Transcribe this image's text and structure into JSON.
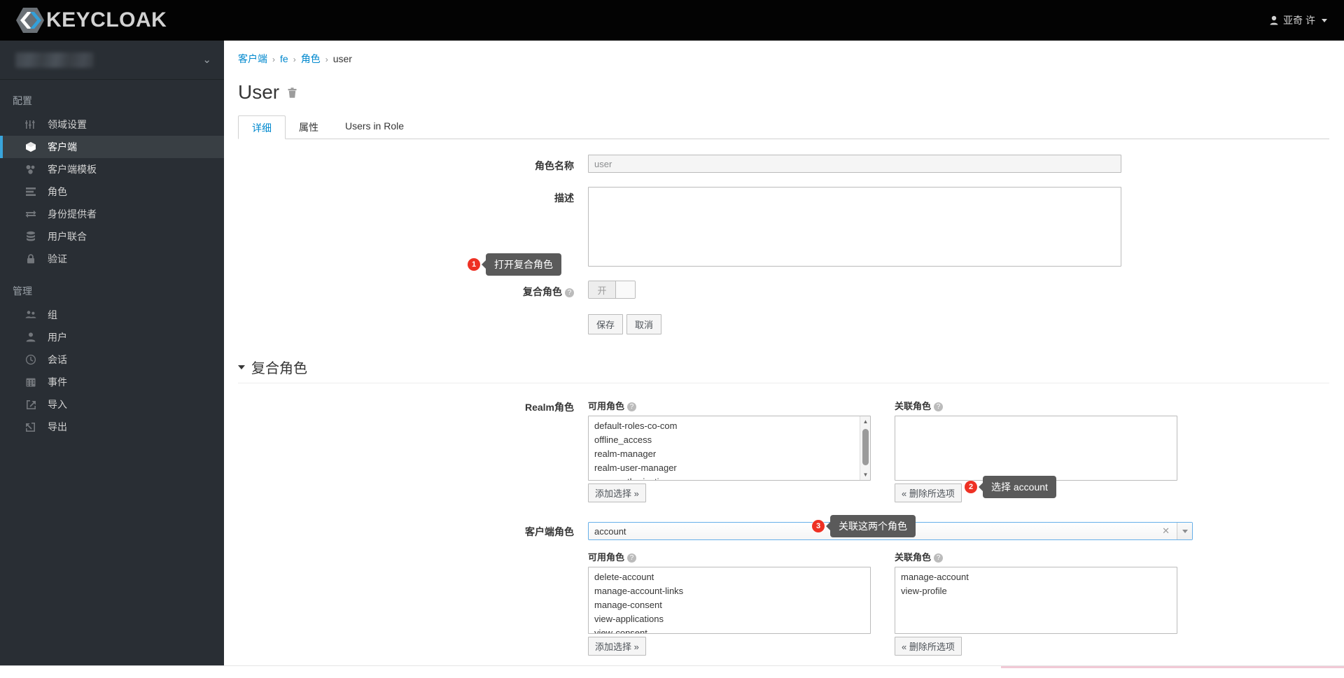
{
  "masthead": {
    "brand": "KEYCLOAK",
    "logo_icon": "keycloak-logo-icon",
    "user_name": "亚奇 许",
    "user_icon": "person-icon",
    "caret_icon": "chevron-down-icon"
  },
  "sidebar": {
    "realm_selector": {
      "name": "",
      "caret_icon": "chevron-down-icon"
    },
    "groups": [
      {
        "label": "配置",
        "items": [
          {
            "label": "领域设置",
            "icon": "sliders-icon",
            "active": false
          },
          {
            "label": "客户端",
            "icon": "cube-icon",
            "active": true
          },
          {
            "label": "客户端模板",
            "icon": "blocks-icon",
            "active": false
          },
          {
            "label": "角色",
            "icon": "list-icon",
            "active": false
          },
          {
            "label": "身份提供者",
            "icon": "exchange-icon",
            "active": false
          },
          {
            "label": "用户联合",
            "icon": "database-icon",
            "active": false
          },
          {
            "label": "验证",
            "icon": "lock-icon",
            "active": false
          }
        ]
      },
      {
        "label": "管理",
        "items": [
          {
            "label": "组",
            "icon": "users-icon",
            "active": false
          },
          {
            "label": "用户",
            "icon": "user-icon",
            "active": false
          },
          {
            "label": "会话",
            "icon": "clock-icon",
            "active": false
          },
          {
            "label": "事件",
            "icon": "calendar-icon",
            "active": false
          },
          {
            "label": "导入",
            "icon": "import-icon",
            "active": false
          },
          {
            "label": "导出",
            "icon": "export-icon",
            "active": false
          }
        ]
      }
    ]
  },
  "breadcrumb": {
    "items": [
      {
        "label": "客户端",
        "link": true
      },
      {
        "label": "fe",
        "link": true
      },
      {
        "label": "角色",
        "link": true
      },
      {
        "label": "user",
        "link": false
      }
    ],
    "separator": "›"
  },
  "page": {
    "title": "User",
    "delete_icon": "trash-icon",
    "tabs": [
      {
        "label": "详细",
        "active": true
      },
      {
        "label": "属性",
        "active": false
      },
      {
        "label": "Users in Role",
        "active": false
      }
    ]
  },
  "form": {
    "role_name_label": "角色名称",
    "role_name_value": "user",
    "description_label": "描述",
    "description_value": "",
    "composite_label": "复合角色",
    "composite_help_icon": "help-circle-icon",
    "composite_switch_on_text": "开",
    "save_label": "保存",
    "cancel_label": "取消"
  },
  "composite_section": {
    "title": "复合角色",
    "caret_icon": "caret-down-icon",
    "realm": {
      "label": "Realm角色",
      "available_label": "可用角色",
      "available_help_icon": "help-circle-icon",
      "available_roles": [
        "default-roles-co-com",
        "offline_access",
        "realm-manager",
        "realm-user-manager",
        "uma_authorization"
      ],
      "add_button": "添加选择 »",
      "associated_label": "关联角色",
      "associated_help_icon": "help-circle-icon",
      "associated_roles": [],
      "remove_button": "« 删除所选项"
    },
    "client": {
      "label": "客户端角色",
      "selected_client": "account",
      "clear_icon": "clear-x-icon",
      "dropdown_icon": "caret-down-icon",
      "available_label": "可用角色",
      "available_help_icon": "help-circle-icon",
      "available_roles": [
        "delete-account",
        "manage-account-links",
        "manage-consent",
        "view-applications",
        "view-consent"
      ],
      "add_button": "添加选择 »",
      "associated_label": "关联角色",
      "associated_help_icon": "help-circle-icon",
      "associated_roles": [
        "manage-account",
        "view-profile"
      ],
      "remove_button": "« 删除所选项"
    }
  },
  "callouts": [
    {
      "number": "1",
      "text": "打开复合角色"
    },
    {
      "number": "2",
      "text": "选择 account"
    },
    {
      "number": "3",
      "text": "关联这两个角色"
    }
  ],
  "colors": {
    "masthead_bg": "#030303",
    "sidebar_bg": "#292e34",
    "active_accent": "#39a5dc",
    "link_blue": "#0088ce",
    "callout_red": "#ee3124",
    "tooltip_gray": "#5a5a5a"
  }
}
